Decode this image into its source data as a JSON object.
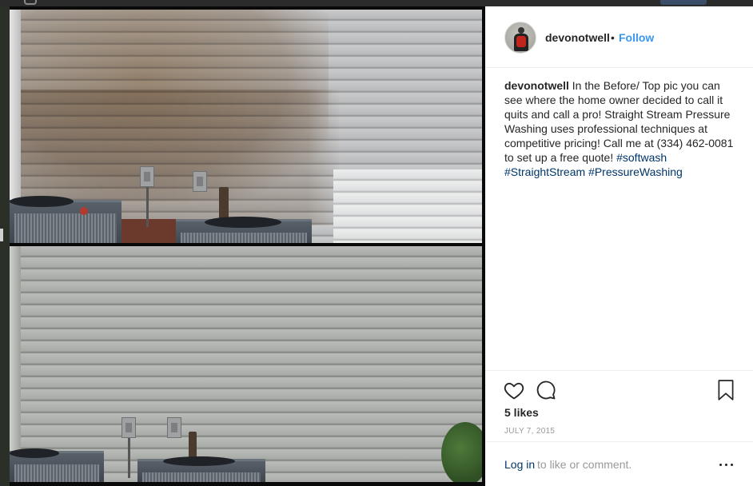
{
  "post": {
    "username": "devonotwell",
    "separator": "•",
    "follow_label": "Follow",
    "caption": {
      "username": "devonotwell",
      "text": "In the Before/ Top pic you can see where the home owner decided to call it quits and call a pro! Straight Stream Pressure Washing uses professional techniques at competitive pricing! Call me at (334) 462-0081 to set up a free quote!",
      "hashtags": [
        "#softwash",
        "#StraightStream",
        "#PressureWashing"
      ]
    },
    "likes": "5 likes",
    "date": "JULY 7, 2015",
    "login_link": "Log in",
    "login_rest": "to like or comment."
  },
  "icons": {
    "like": "heart-icon",
    "comment": "comment-icon",
    "save": "bookmark-icon",
    "more": "more-options-icon"
  },
  "colors": {
    "follow": "#3897f0",
    "link": "#003569",
    "muted": "#999999",
    "text": "#262626"
  }
}
